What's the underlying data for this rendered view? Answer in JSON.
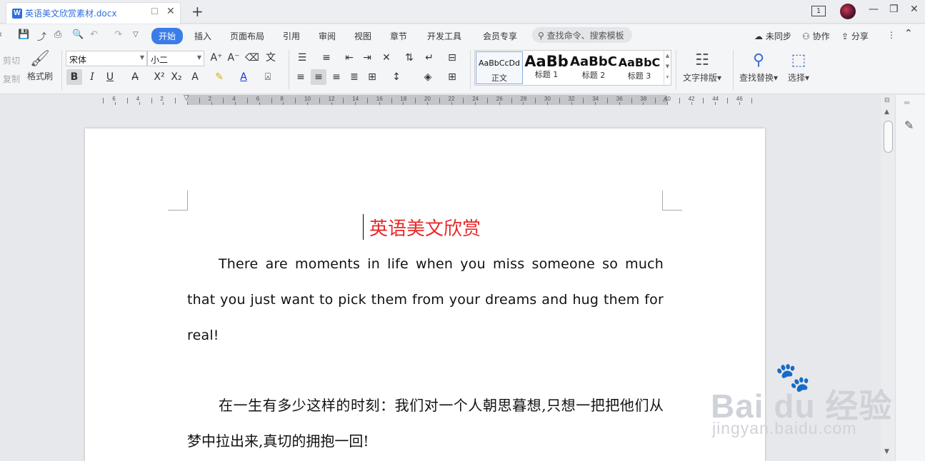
{
  "window": {
    "tab_title": "英语美文欣赏素材.docx",
    "tab_icon": "W",
    "pin_icon": "☐",
    "close_icon": "✕",
    "new_tab": "+",
    "page_count": "1",
    "minimize": "—",
    "restore": "❐",
    "close": "✕"
  },
  "menubar": {
    "items": [
      "开始",
      "插入",
      "页面布局",
      "引用",
      "审阅",
      "视图",
      "章节",
      "开发工具",
      "会员专享"
    ],
    "active_index": 0,
    "search_placeholder": "查找命令、搜索模板",
    "sync": "未同步",
    "collab": "协作",
    "share": "分享"
  },
  "ribbon": {
    "cut": "剪切",
    "copy": "复制",
    "format_painter": "格式刷",
    "font_name": "宋体",
    "font_size": "小二",
    "bold": "B",
    "italic": "I",
    "underline": "U",
    "styles": [
      {
        "sample": "AaBbCcDd",
        "name": "正文"
      },
      {
        "sample": "AaBb",
        "name": "标题 1"
      },
      {
        "sample": "AaBbC",
        "name": "标题 2"
      },
      {
        "sample": "AaBbC",
        "name": "标题 3"
      }
    ],
    "text_layout": "文字排版",
    "find_replace": "查找替换",
    "select": "选择"
  },
  "ruler": {
    "labels": [
      "6",
      "4",
      "2",
      "2",
      "4",
      "6",
      "8",
      "10",
      "12",
      "14",
      "16",
      "18",
      "20",
      "22",
      "24",
      "26",
      "28",
      "30",
      "32",
      "34",
      "36",
      "38",
      "40",
      "42",
      "44",
      "46"
    ]
  },
  "document": {
    "title": "英语美文欣赏",
    "title_color": "#e8292a",
    "paragraph_en": "There are moments in life when you miss someone so much that you just want to pick them from your dreams and hug them for real!",
    "paragraph_zh": "在一生有多少这样的时刻：我们对一个人朝思暮想,只想一把把他们从梦中拉出来,真切的拥抱一回!"
  },
  "watermark": {
    "paw": "🐾",
    "brand": "Bai du 经验",
    "url": "jingyan.baidu.com"
  },
  "colors": {
    "accent": "#3b7de8",
    "title_red": "#e8292a"
  }
}
